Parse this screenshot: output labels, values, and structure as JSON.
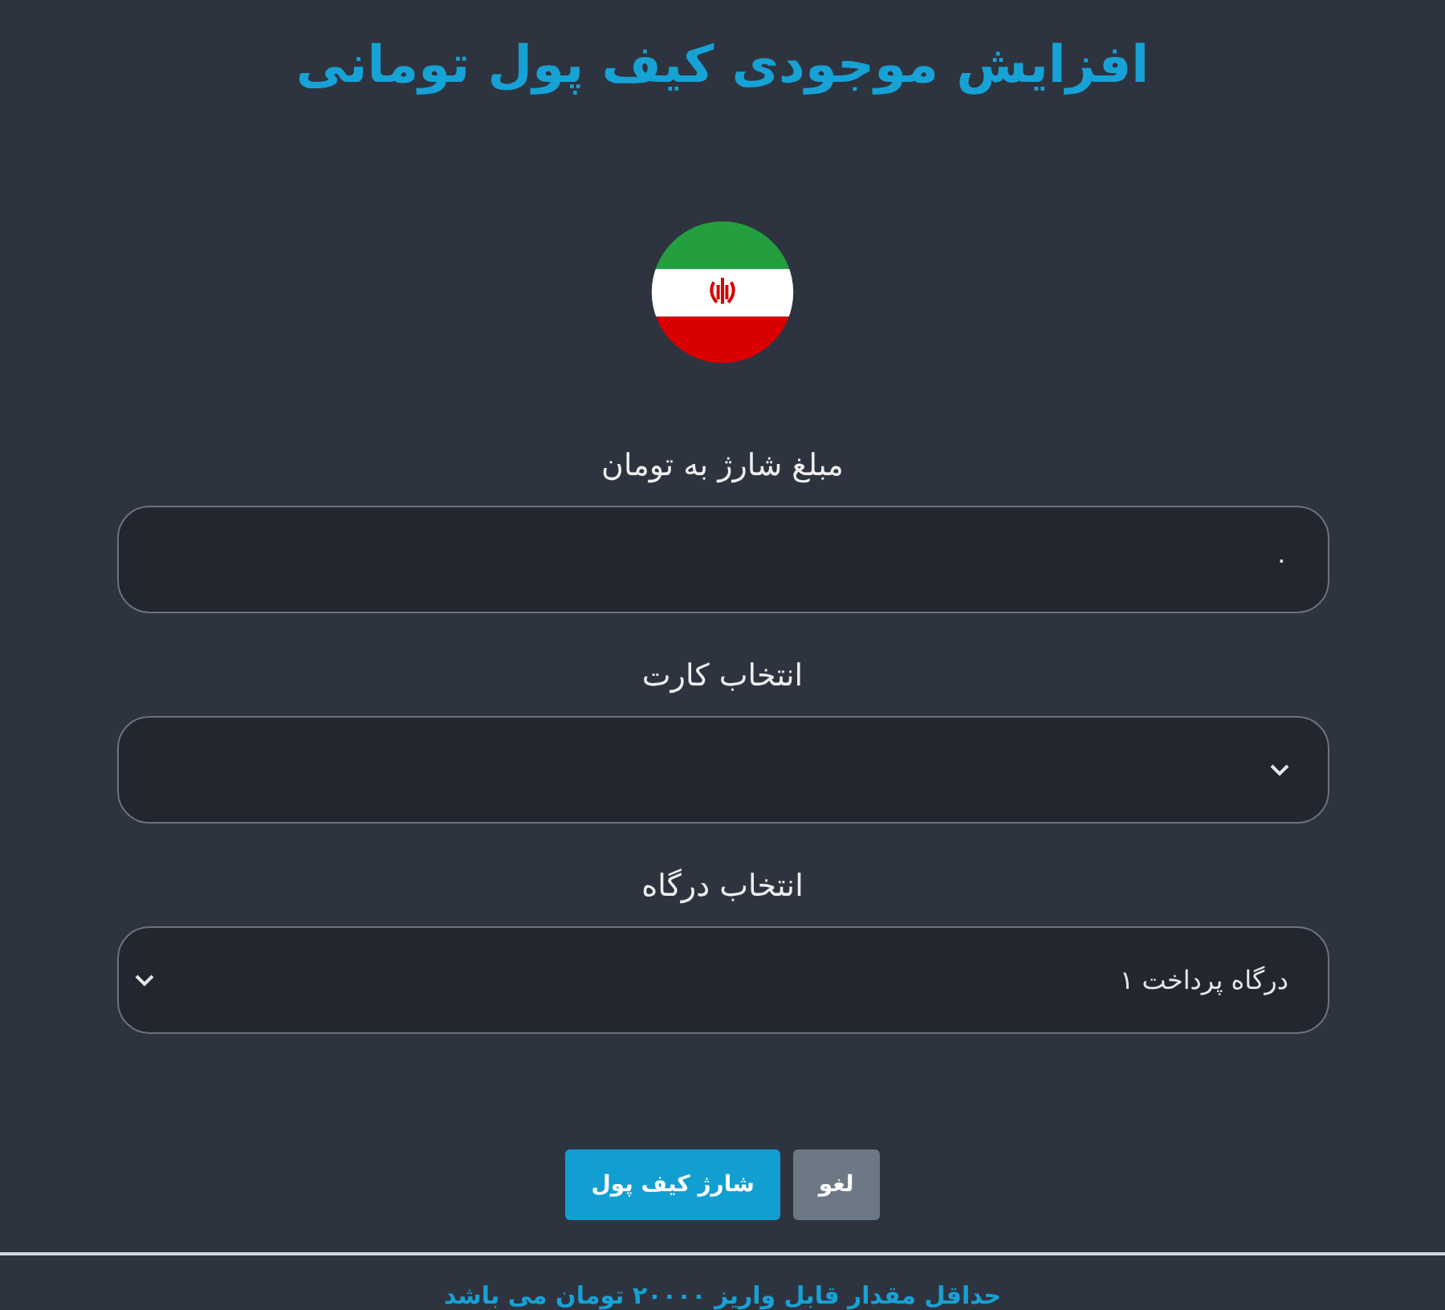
{
  "title": "افزایش موجودی کیف پول تومانی",
  "fields": [
    {
      "kind": "input",
      "label": "مبلغ شارژ به تومان",
      "value": "۰"
    },
    {
      "kind": "select",
      "label": "انتخاب کارت"
    },
    {
      "kind": "select",
      "label": "انتخاب درگاه",
      "value": "درگاه پرداخت ۱"
    }
  ],
  "buttons": [
    {
      "kind": "secondary",
      "label": "لغو"
    },
    {
      "kind": "primary",
      "label": "شارژ کیف پول"
    }
  ],
  "note": "حداقل مقدار قابل واریز ۲۰۰۰۰ تومان می باشد"
}
